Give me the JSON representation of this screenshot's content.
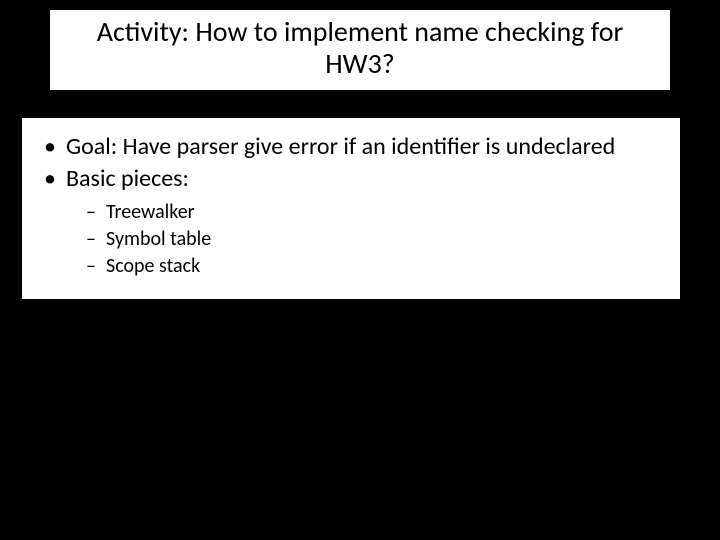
{
  "title": "Activity: How to implement name checking for HW3?",
  "bullets": {
    "b1": "Goal: Have parser give error if an identifier is undeclared",
    "b2": "Basic pieces:",
    "sub": {
      "s1": "Treewalker",
      "s2": "Symbol table",
      "s3": "Scope stack"
    }
  }
}
